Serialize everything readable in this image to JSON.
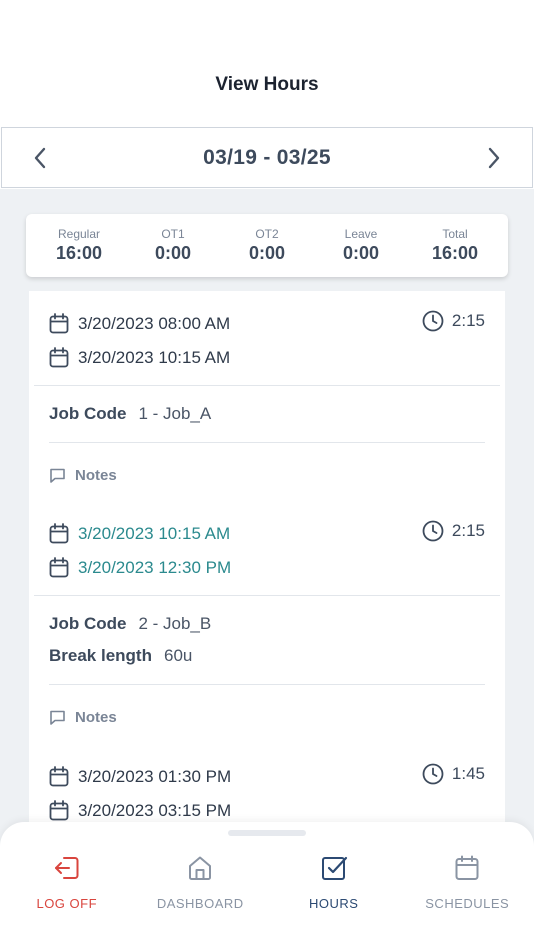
{
  "header": {
    "title": "View Hours"
  },
  "date_nav": {
    "range": "03/19 - 03/25",
    "prev_icon": "chevron-left-icon",
    "next_icon": "chevron-right-icon"
  },
  "summary": [
    {
      "label": "Regular",
      "value": "16:00"
    },
    {
      "label": "OT1",
      "value": "0:00"
    },
    {
      "label": "OT2",
      "value": "0:00"
    },
    {
      "label": "Leave",
      "value": "0:00"
    },
    {
      "label": "Total",
      "value": "16:00"
    }
  ],
  "entries": [
    {
      "start": "3/20/2023 08:00 AM",
      "end": "3/20/2023 10:15 AM",
      "duration": "2:15",
      "job_code_label": "Job Code",
      "job_code": "1 - Job_A",
      "notes_label": "Notes"
    },
    {
      "start": "3/20/2023 10:15 AM",
      "end": "3/20/2023 12:30 PM",
      "duration": "2:15",
      "job_code_label": "Job Code",
      "job_code": "2 - Job_B",
      "break_label": "Break length",
      "break_value": "60u",
      "notes_label": "Notes"
    },
    {
      "start": "3/20/2023 01:30 PM",
      "end": "3/20/2023 03:15 PM",
      "duration": "1:45"
    }
  ],
  "tabs": [
    {
      "label": "LOG OFF",
      "icon": "log-off-icon"
    },
    {
      "label": "DASHBOARD",
      "icon": "home-icon"
    },
    {
      "label": "HOURS",
      "icon": "checkbox-icon"
    },
    {
      "label": "SCHEDULES",
      "icon": "calendar-icon"
    }
  ],
  "colors": {
    "accent_teal": "#2b8a8e",
    "logoff_red": "#d9453e",
    "active_navy": "#2c4a73",
    "text": "#3d4a5c"
  }
}
